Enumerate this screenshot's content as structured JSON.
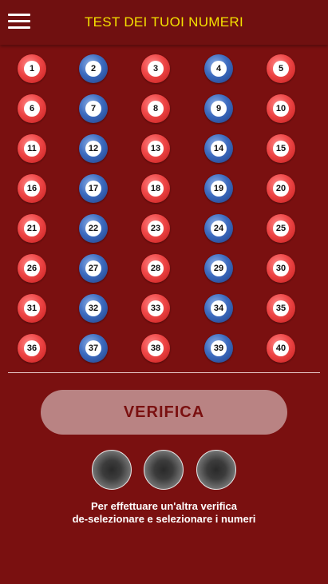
{
  "header": {
    "title": "TEST DEI TUOI NUMERI",
    "menu_icon": "hamburger-menu-icon"
  },
  "colors": {
    "background": "#7a1010",
    "title": "#f5e200",
    "red_ball": "#e84a4a",
    "blue_ball": "#3a63b8",
    "button_bg": "#b98383",
    "button_text": "#7a1010"
  },
  "numbers": [
    {
      "n": "1",
      "color": "red"
    },
    {
      "n": "2",
      "color": "blue"
    },
    {
      "n": "3",
      "color": "red"
    },
    {
      "n": "4",
      "color": "blue"
    },
    {
      "n": "5",
      "color": "red"
    },
    {
      "n": "6",
      "color": "red"
    },
    {
      "n": "7",
      "color": "blue"
    },
    {
      "n": "8",
      "color": "red"
    },
    {
      "n": "9",
      "color": "blue"
    },
    {
      "n": "10",
      "color": "red"
    },
    {
      "n": "11",
      "color": "red"
    },
    {
      "n": "12",
      "color": "blue"
    },
    {
      "n": "13",
      "color": "red"
    },
    {
      "n": "14",
      "color": "blue"
    },
    {
      "n": "15",
      "color": "red"
    },
    {
      "n": "16",
      "color": "red"
    },
    {
      "n": "17",
      "color": "blue"
    },
    {
      "n": "18",
      "color": "red"
    },
    {
      "n": "19",
      "color": "blue"
    },
    {
      "n": "20",
      "color": "red"
    },
    {
      "n": "21",
      "color": "red"
    },
    {
      "n": "22",
      "color": "blue"
    },
    {
      "n": "23",
      "color": "red"
    },
    {
      "n": "24",
      "color": "blue"
    },
    {
      "n": "25",
      "color": "red"
    },
    {
      "n": "26",
      "color": "red"
    },
    {
      "n": "27",
      "color": "blue"
    },
    {
      "n": "28",
      "color": "red"
    },
    {
      "n": "29",
      "color": "blue"
    },
    {
      "n": "30",
      "color": "red"
    },
    {
      "n": "31",
      "color": "red"
    },
    {
      "n": "32",
      "color": "blue"
    },
    {
      "n": "33",
      "color": "red"
    },
    {
      "n": "34",
      "color": "blue"
    },
    {
      "n": "35",
      "color": "red"
    },
    {
      "n": "36",
      "color": "red"
    },
    {
      "n": "37",
      "color": "blue"
    },
    {
      "n": "38",
      "color": "red"
    },
    {
      "n": "39",
      "color": "blue"
    },
    {
      "n": "40",
      "color": "red"
    }
  ],
  "verify_button": {
    "label": "VERIFICA"
  },
  "result_slots": [
    {
      "state": "empty"
    },
    {
      "state": "empty"
    },
    {
      "state": "empty"
    }
  ],
  "info": {
    "line1": "Per effettuare un'altra verifica",
    "line2": "de-selezionare e selezionare i numeri"
  }
}
